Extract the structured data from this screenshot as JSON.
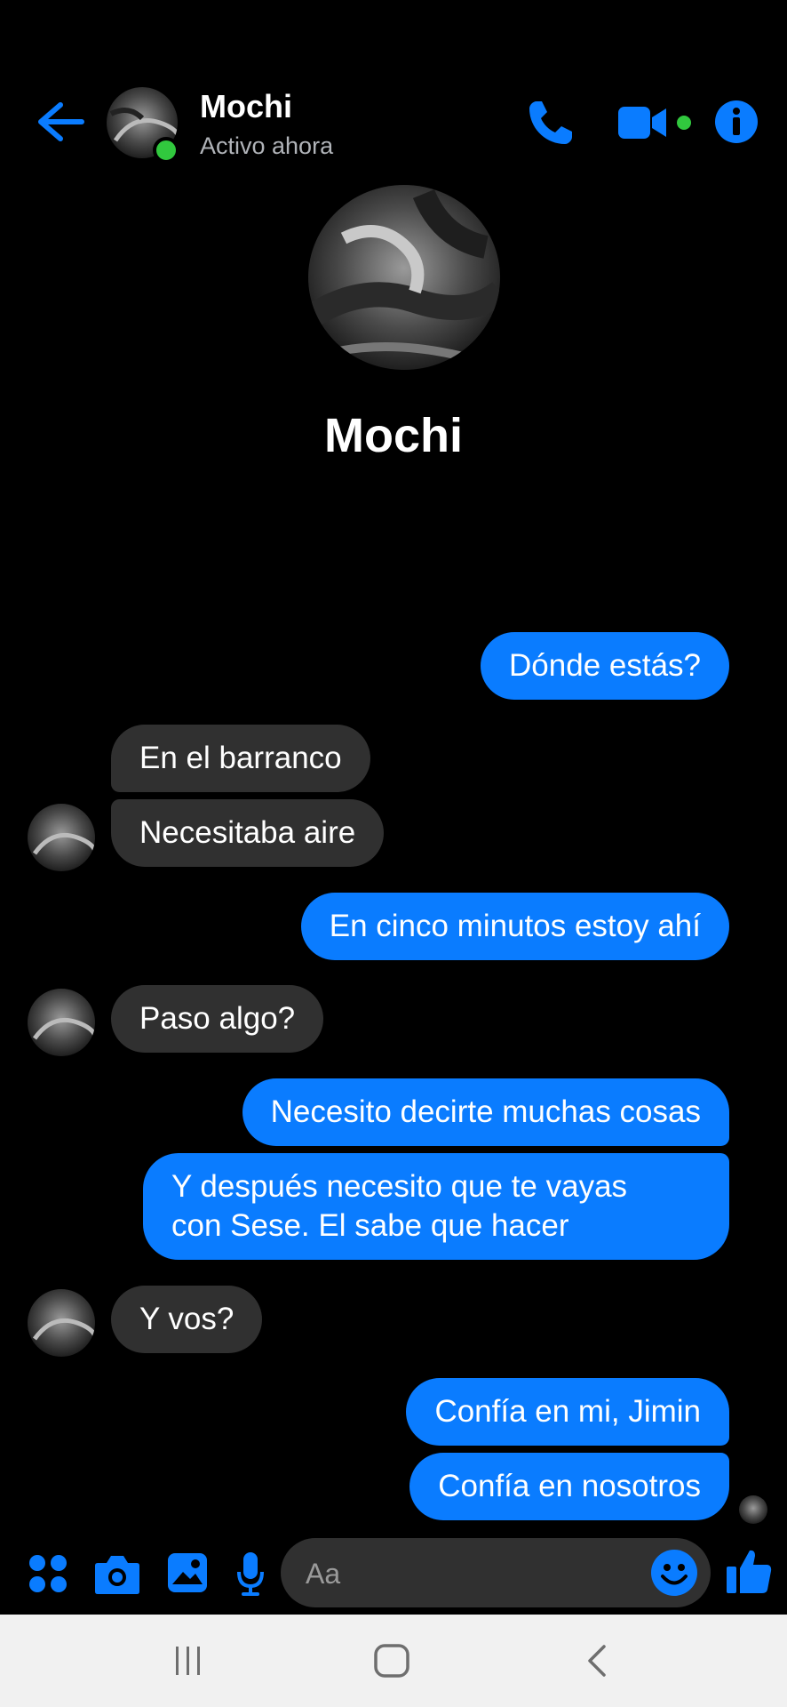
{
  "header": {
    "contact_name": "Mochi",
    "status": "Activo ahora",
    "accent_color": "#0a7cff",
    "online_color": "#31c83e"
  },
  "profile": {
    "name": "Mochi"
  },
  "messages": [
    {
      "side": "out",
      "text": "Dónde estás?"
    },
    {
      "side": "in",
      "text": "En el barranco"
    },
    {
      "side": "in",
      "text": "Necesitaba aire"
    },
    {
      "side": "out",
      "text": "En cinco minutos estoy ahí"
    },
    {
      "side": "in",
      "text": "Paso algo?"
    },
    {
      "side": "out",
      "text": "Necesito decirte muchas cosas"
    },
    {
      "side": "out",
      "text": "Y después necesito que te vayas\ncon Sese. El sabe que hacer"
    },
    {
      "side": "in",
      "text": "Y vos?"
    },
    {
      "side": "out",
      "text": "Confía en mi, Jimin"
    },
    {
      "side": "out",
      "text": "Confía en nosotros"
    }
  ],
  "composer": {
    "placeholder": "Aa",
    "icons": [
      "apps-icon",
      "camera-icon",
      "gallery-icon",
      "microphone-icon",
      "emoji-icon",
      "thumbs-up-icon"
    ]
  },
  "navbar": {
    "icons": [
      "recents-icon",
      "home-icon",
      "back-nav-icon"
    ]
  }
}
